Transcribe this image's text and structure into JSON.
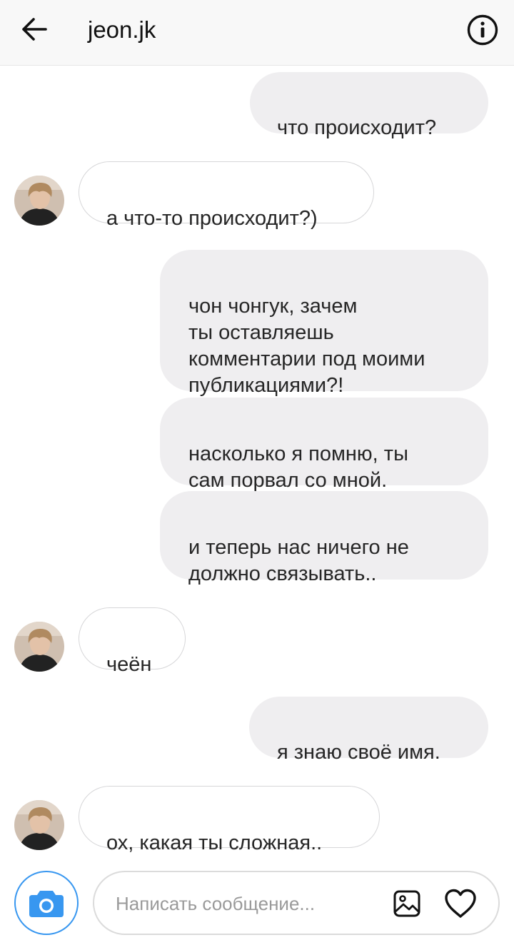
{
  "header": {
    "username": "jeon.jk",
    "back_icon": "arrow-left-icon",
    "info_icon": "info-circle-icon"
  },
  "messages": [
    {
      "direction": "outgoing",
      "text": "что происходит?"
    },
    {
      "direction": "incoming",
      "text": "а что-то происходит?)"
    },
    {
      "direction": "outgoing",
      "text": "чон чонгук, зачем\nты оставляешь\nкомментарии под моими\nпубликациями?!"
    },
    {
      "direction": "outgoing",
      "text": "насколько я помню, ты\nсам порвал со мной."
    },
    {
      "direction": "outgoing",
      "text": "и теперь нас ничего не\nдолжно связывать.."
    },
    {
      "direction": "incoming",
      "text": "чеён"
    },
    {
      "direction": "outgoing",
      "text": "я знаю своё имя."
    },
    {
      "direction": "incoming",
      "text": "ох, какая ты сложная.."
    }
  ],
  "composer": {
    "placeholder": "Написать сообщение...",
    "value": "",
    "camera_icon": "camera-icon",
    "gallery_icon": "image-icon",
    "like_icon": "heart-icon"
  },
  "colors": {
    "accent": "#3897f0",
    "outgoing_bubble": "#efeef0",
    "incoming_border": "#d6d6d8",
    "header_bg": "#f8f8f8"
  }
}
